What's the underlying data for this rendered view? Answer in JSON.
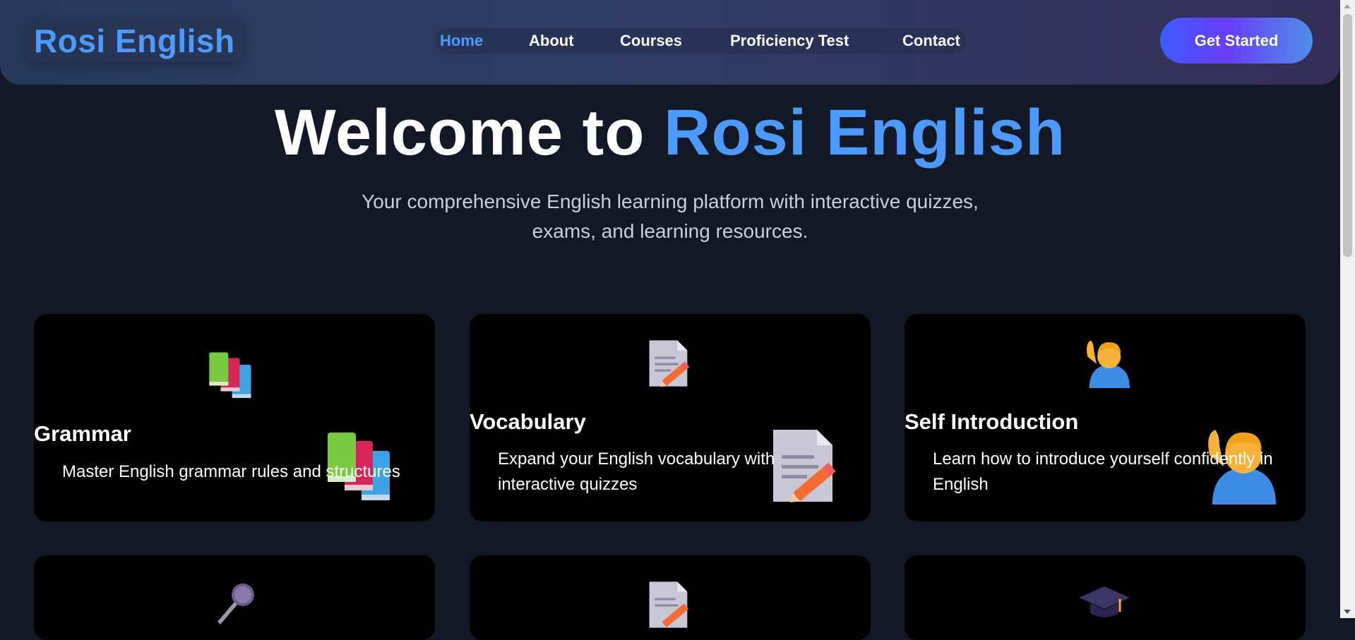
{
  "brand": {
    "name": "Rosi English"
  },
  "nav": {
    "items": [
      {
        "label": "Home",
        "active": true
      },
      {
        "label": "About",
        "active": false
      },
      {
        "label": "Courses",
        "active": false
      },
      {
        "label": "Proficiency Test",
        "active": false
      },
      {
        "label": "Contact",
        "active": false
      }
    ],
    "cta_label": "Get Started"
  },
  "hero": {
    "title_prefix": "Welcome to",
    "title_accent": "Rosi English",
    "subtitle_line1": "Your comprehensive English learning platform with interactive quizzes,",
    "subtitle_line2": "exams, and learning resources."
  },
  "cards": [
    {
      "icon": "books-icon",
      "title": "Grammar",
      "description": "Master English grammar rules and structures"
    },
    {
      "icon": "memo-icon",
      "title": "Vocabulary",
      "description_line1": "Expand your English vocabulary with",
      "description_line2": "interactive quizzes"
    },
    {
      "icon": "person-raising-hand-icon",
      "title": "Self Introduction",
      "description_line1": "Learn how to introduce yourself confidently in",
      "description_line2": "English"
    }
  ],
  "partial_cards": [
    {
      "icon": "microphone-icon"
    },
    {
      "icon": "memo-icon"
    },
    {
      "icon": "graduation-cap-icon"
    }
  ],
  "colors": {
    "background": "#121826",
    "accent": "#4d9aff",
    "card": "#000000",
    "cta_gradient_start": "#3b5bff",
    "cta_gradient_end": "#4e8fe8"
  }
}
